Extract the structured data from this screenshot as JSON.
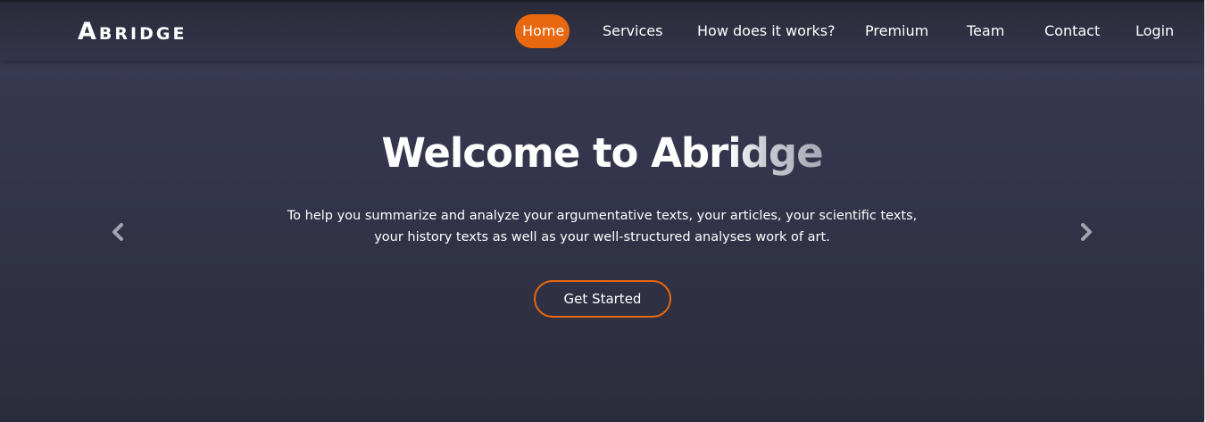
{
  "brand": {
    "logo_text": "Abridge"
  },
  "nav": {
    "items": [
      {
        "label": "Home",
        "active": true
      },
      {
        "label": "Services",
        "active": false
      },
      {
        "label": "How does it works?",
        "active": false
      },
      {
        "label": "Premium",
        "active": false
      },
      {
        "label": "Team",
        "active": false
      },
      {
        "label": "Contact",
        "active": false
      },
      {
        "label": "Login",
        "active": false
      }
    ]
  },
  "hero": {
    "title_main": "Welcome to Abr",
    "title_fade": "idge",
    "description_line1": "To help you summarize and analyze your argumentative texts, your articles, your scientific texts,",
    "description_line2": "your history texts as well as your well-structured analyses work of art.",
    "cta_label": "Get Started"
  },
  "carousel": {
    "prev_icon": "chevron-left-icon",
    "next_icon": "chevron-right-icon"
  },
  "colors": {
    "accent": "#e8680f",
    "background": "#33344a",
    "text": "#ffffff",
    "arrow": "#a4a4b1"
  }
}
